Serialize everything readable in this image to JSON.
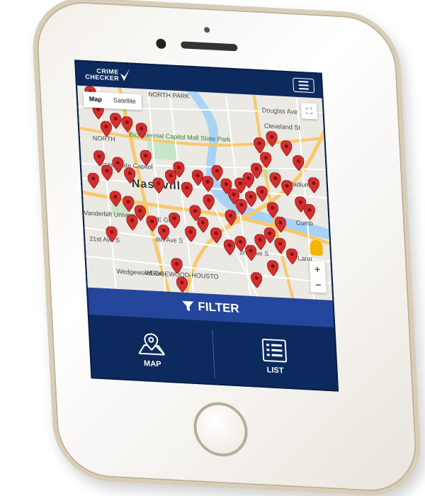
{
  "app": {
    "logo_line1": "CRIME",
    "logo_line2": "CHECKER"
  },
  "map": {
    "type_options": [
      "Map",
      "Satellite"
    ],
    "selected_type": "Map",
    "labels": {
      "north_park": "NORTH PARK",
      "north": "NORTH",
      "nashville": "Nashville",
      "bicentennial": "Bicentennial Capitol Mall State Park",
      "state_capitol": "ssee State Capitol",
      "vanderbilt": "Vanderbilt University",
      "the_gulch": "THE GU",
      "wedgewood": "WEDGEWOOD-HOUSTO",
      "stadium": "Stadium",
      "douglas_ave": "Douglas Ave",
      "cleveland_st": "Cleveland St",
      "second_ave": "2nd Ave S",
      "twentyfirst_ave": "21st Ave S",
      "eighth_ave": "8th Ave S",
      "wedgewood_ave": "Wedgewood Ave",
      "cumb": "Cumb",
      "lang": "Lang"
    },
    "zoom_in": "+",
    "zoom_out": "−"
  },
  "filter": {
    "label": "FILTER"
  },
  "nav": {
    "map_label": "MAP",
    "list_label": "LIST"
  },
  "colors": {
    "header_bg": "#0d2a5e",
    "filter_bg": "#24469c",
    "pin_red": "#d32f2f"
  }
}
